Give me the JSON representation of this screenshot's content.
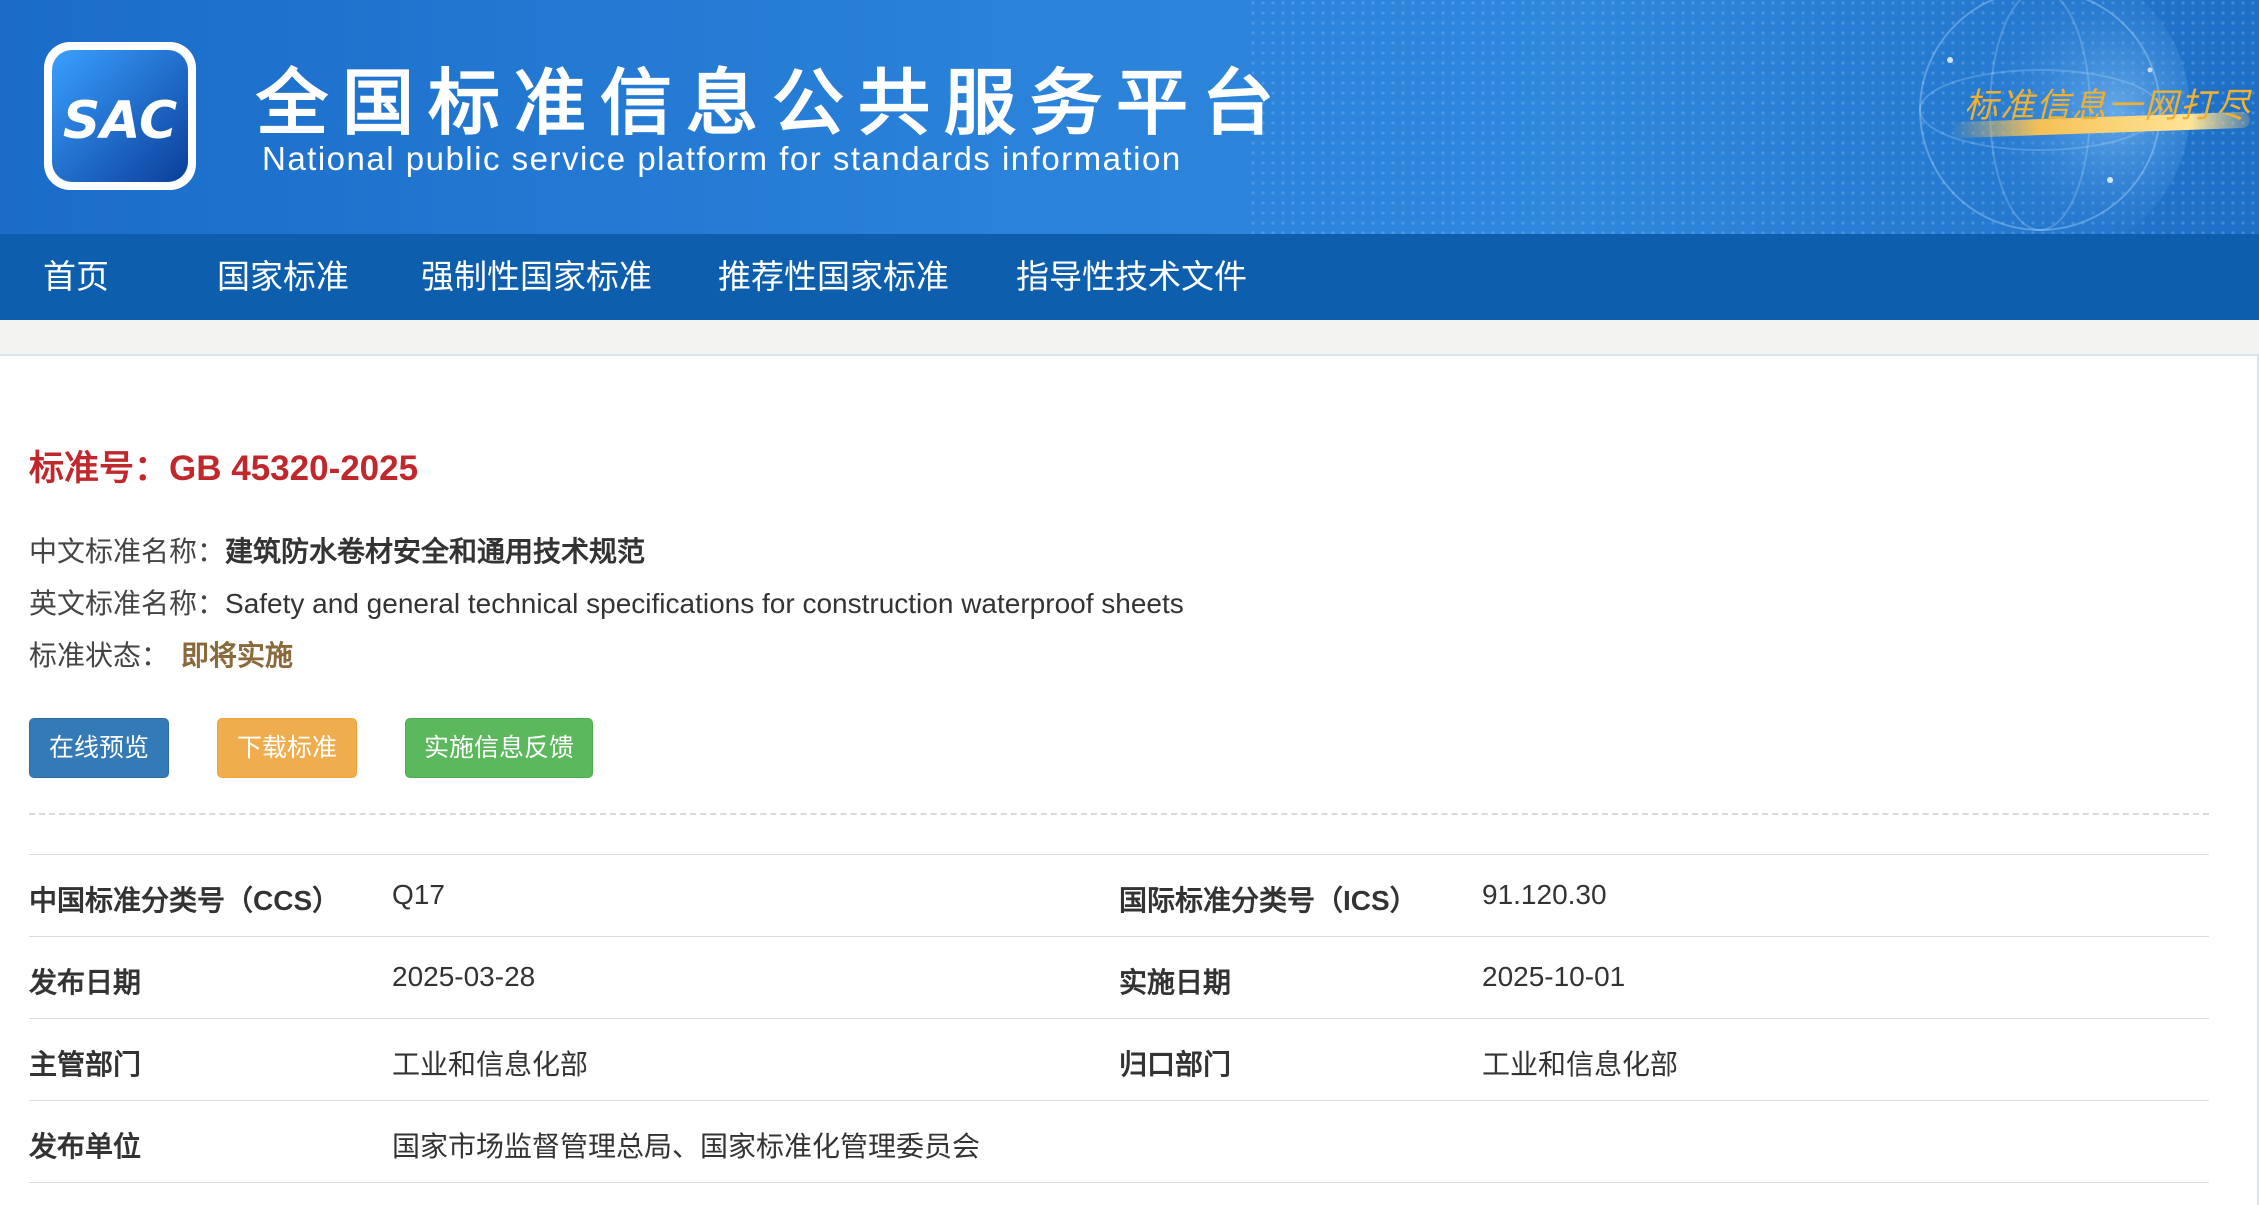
{
  "header": {
    "logo_text": "SAC",
    "title": "全国标准信息公共服务平台",
    "subtitle": "National public service platform  for standards information",
    "slogan": "标准信息一网打尽"
  },
  "nav": {
    "items": [
      {
        "label": "首页"
      },
      {
        "label": "国家标准"
      },
      {
        "label": "强制性国家标准"
      },
      {
        "label": "推荐性国家标准"
      },
      {
        "label": "指导性技术文件"
      }
    ]
  },
  "standard": {
    "number_label": "标准号：",
    "number": "GB 45320-2025",
    "cn_name_label": "中文标准名称：",
    "cn_name": "建筑防水卷材安全和通用技术规范",
    "en_name_label": "英文标准名称：",
    "en_name": "Safety and general technical specifications for construction waterproof sheets",
    "status_label": "标准状态：",
    "status": "即将实施"
  },
  "buttons": {
    "preview": "在线预览",
    "download": "下载标准",
    "feedback": "实施信息反馈"
  },
  "colors": {
    "nav_bg": "#0d5fad",
    "number_red": "#c0282b",
    "status_brown": "#8a6a3a",
    "preview": "#337ab7",
    "download": "#f0ad4e",
    "feedback": "#5cb85c"
  },
  "details": [
    {
      "l1": "中国标准分类号（CCS）",
      "v1": "Q17",
      "l2": "国际标准分类号（ICS）",
      "v2": "91.120.30"
    },
    {
      "l1": "发布日期",
      "v1": "2025-03-28",
      "l2": "实施日期",
      "v2": "2025-10-01"
    },
    {
      "l1": "主管部门",
      "v1": "工业和信息化部",
      "l2": "归口部门",
      "v2": "工业和信息化部"
    },
    {
      "l1": "发布单位",
      "v1": "国家市场监督管理总局、国家标准化管理委员会",
      "l2": "",
      "v2": ""
    }
  ]
}
